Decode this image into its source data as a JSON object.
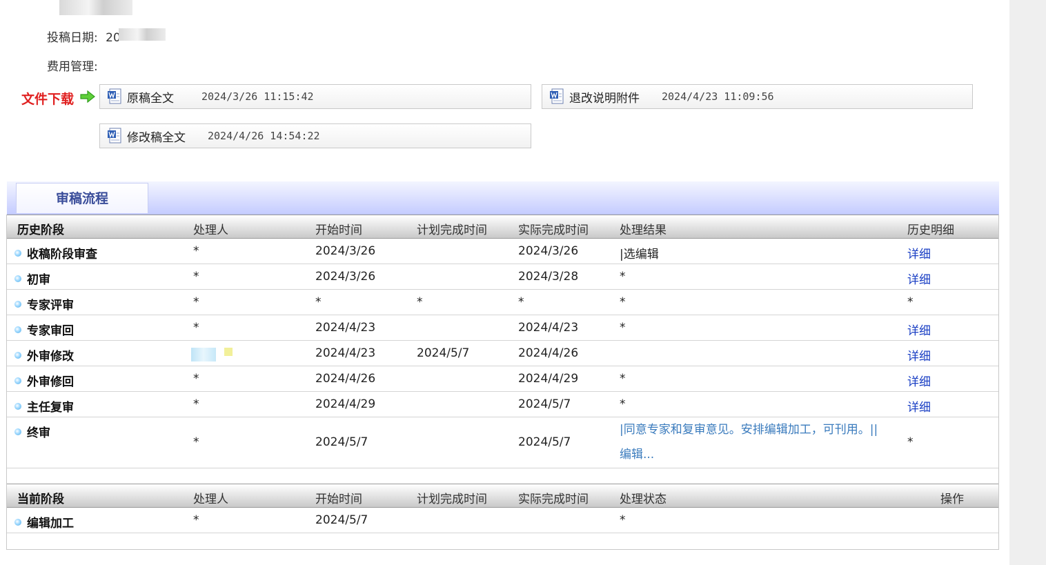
{
  "info": {
    "submit_date_label": "投稿日期:",
    "submit_date_value": "20",
    "fee_label": "费用管理:"
  },
  "downloads": {
    "title": "文件下载",
    "files": [
      {
        "name": "原稿全文",
        "time": "2024/3/26 11:15:42"
      },
      {
        "name": "退改说明附件",
        "time": "2024/4/23 11:09:56"
      },
      {
        "name": "修改稿全文",
        "time": "2024/4/26 14:54:22"
      }
    ]
  },
  "flow": {
    "tab_title": "审稿流程",
    "history_headers": [
      "历史阶段",
      "处理人",
      "开始时间",
      "计划完成时间",
      "实际完成时间",
      "处理结果",
      "历史明细"
    ],
    "history_rows": [
      {
        "stage": "收稿阶段审查",
        "handler": "*",
        "start": "2024/3/26",
        "planned": "",
        "actual": "2024/3/26",
        "result": "|选编辑",
        "detail": "详细"
      },
      {
        "stage": "初审",
        "handler": "*",
        "start": "2024/3/26",
        "planned": "",
        "actual": "2024/3/28",
        "result": "*",
        "detail": "详细"
      },
      {
        "stage": "专家评审",
        "handler": "*",
        "start": "*",
        "planned": "*",
        "actual": "*",
        "result": "*",
        "detail": "*"
      },
      {
        "stage": "专家审回",
        "handler": "*",
        "start": "2024/4/23",
        "planned": "",
        "actual": "2024/4/23",
        "result": "*",
        "detail": "详细"
      },
      {
        "stage": "外审修改",
        "handler": "",
        "start": "2024/4/23",
        "planned": "2024/5/7",
        "actual": "2024/4/26",
        "result": "",
        "detail": "详细"
      },
      {
        "stage": "外审修回",
        "handler": "*",
        "start": "2024/4/26",
        "planned": "",
        "actual": "2024/4/29",
        "result": "*",
        "detail": "详细"
      },
      {
        "stage": "主任复审",
        "handler": "*",
        "start": "2024/4/29",
        "planned": "",
        "actual": "2024/5/7",
        "result": "*",
        "detail": "详细"
      },
      {
        "stage": "终审",
        "handler": "*",
        "start": "2024/5/7",
        "planned": "",
        "actual": "2024/5/7",
        "result_line1": "|同意专家和复审意见。安排编辑加工，可刊用。||",
        "result_line2": "编辑...",
        "detail": "*"
      }
    ],
    "current_headers": [
      "当前阶段",
      "处理人",
      "开始时间",
      "计划完成时间",
      "实际完成时间",
      "处理状态",
      "操作"
    ],
    "current_rows": [
      {
        "stage": "编辑加工",
        "handler": "*",
        "start": "2024/5/7",
        "planned": "",
        "actual": "",
        "status": "*",
        "action": ""
      }
    ]
  },
  "colors": {
    "download_title": "#e02020",
    "link": "#1a3fc4",
    "result_link": "#3a7bbd",
    "tab_text": "#3a4d9a",
    "header_gradient_end": "#c5ccff"
  }
}
